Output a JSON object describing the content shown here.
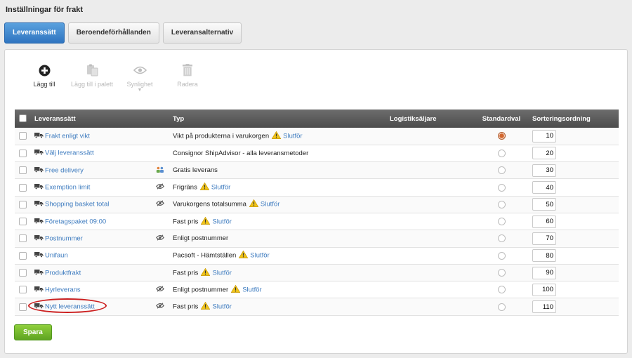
{
  "page": {
    "title": "Inställningar för frakt"
  },
  "tabs": [
    {
      "label": "Leveranssätt",
      "active": true
    },
    {
      "label": "Beroendeförhållanden",
      "active": false
    },
    {
      "label": "Leveransalternativ",
      "active": false
    }
  ],
  "toolbar": {
    "add": "Lägg till",
    "add_from_list": "Lägg till i palett",
    "visibility": "Synlighet",
    "visibility_caret": "▼",
    "delete": "Radera"
  },
  "table": {
    "headers": {
      "method": "Leveranssätt",
      "type": "Typ",
      "logistics": "Logistiksäljare",
      "default": "Standardval",
      "sort": "Sorteringsordning"
    },
    "finish_label": "Slutför",
    "rows": [
      {
        "name": "Frakt enligt vikt",
        "icon": "",
        "type": "Vikt på produkterna i varukorgen",
        "warning": true,
        "default": true,
        "sort": "10"
      },
      {
        "name": "Välj leveranssätt",
        "icon": "",
        "type": "Consignor ShipAdvisor - alla leveransmetoder",
        "warning": false,
        "default": false,
        "sort": "20"
      },
      {
        "name": "Free delivery",
        "icon": "group",
        "type": "Gratis leverans",
        "warning": false,
        "default": false,
        "sort": "30"
      },
      {
        "name": "Exemption limit",
        "icon": "hidden",
        "type": "Frigräns",
        "warning": true,
        "default": false,
        "sort": "40"
      },
      {
        "name": "Shopping basket total",
        "icon": "hidden",
        "type": "Varukorgens totalsumma",
        "warning": true,
        "default": false,
        "sort": "50"
      },
      {
        "name": "Företagspaket 09:00",
        "icon": "",
        "type": "Fast pris",
        "warning": true,
        "default": false,
        "sort": "60"
      },
      {
        "name": "Postnummer",
        "icon": "hidden",
        "type": "Enligt postnummer",
        "warning": false,
        "default": false,
        "sort": "70"
      },
      {
        "name": "Unifaun",
        "icon": "",
        "type": "Pacsoft - Hämtställen",
        "warning": true,
        "default": false,
        "sort": "80"
      },
      {
        "name": "Produktfrakt",
        "icon": "",
        "type": "Fast pris",
        "warning": true,
        "default": false,
        "sort": "90"
      },
      {
        "name": "Hyrleverans",
        "icon": "hidden",
        "type": "Enligt postnummer",
        "warning": true,
        "default": false,
        "sort": "100"
      },
      {
        "name": "Nytt leveranssätt",
        "icon": "hidden",
        "type": "Fast pris",
        "warning": true,
        "default": false,
        "sort": "110"
      }
    ]
  },
  "actions": {
    "save": "Spara"
  },
  "colors": {
    "accent": "#2f74c0",
    "link": "#3d7bbf",
    "save": "#6fb52c",
    "highlight": "#cc1f1f",
    "warning": "#f0c419"
  }
}
